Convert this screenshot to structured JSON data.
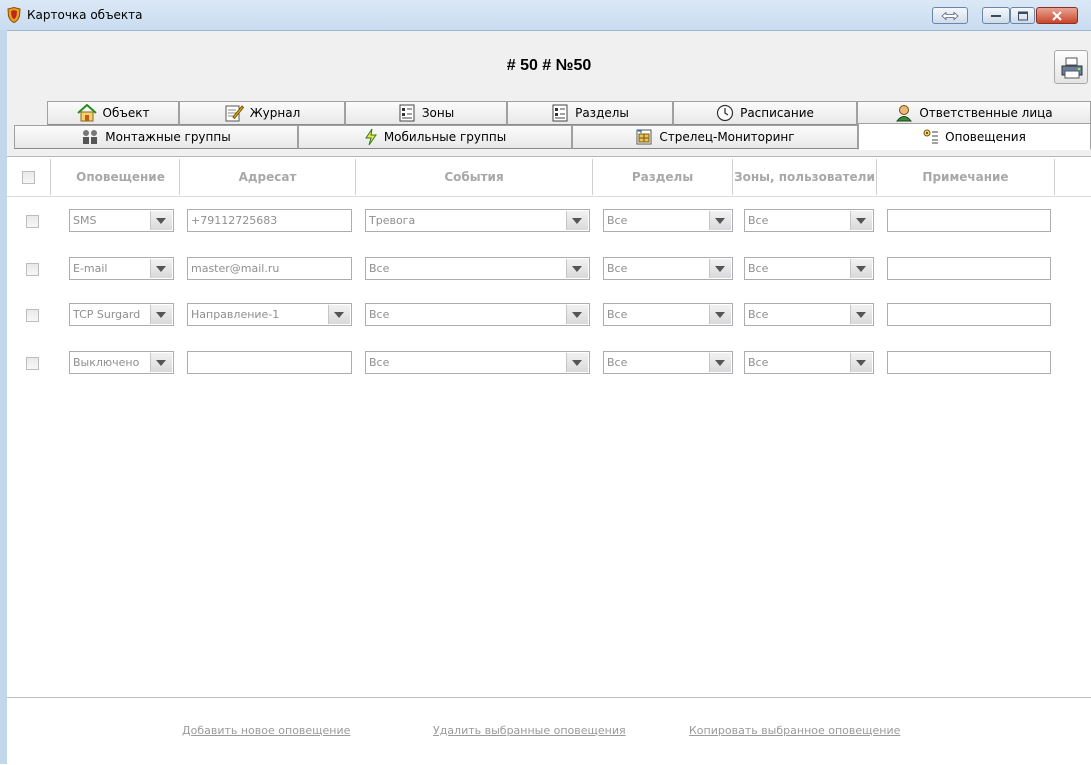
{
  "window": {
    "title": "Карточка объекта",
    "heading": "# 50 # №50"
  },
  "tabs_row1": [
    {
      "label": "Объект",
      "icon": "house-icon"
    },
    {
      "label": "Журнал",
      "icon": "journal-icon"
    },
    {
      "label": "Зоны",
      "icon": "zones-icon"
    },
    {
      "label": "Разделы",
      "icon": "sections-icon"
    },
    {
      "label": "Расписание",
      "icon": "clock-icon"
    },
    {
      "label": "Ответственные лица",
      "icon": "person-icon"
    }
  ],
  "tabs_row2": [
    {
      "label": "Монтажные группы",
      "icon": "installers-icon"
    },
    {
      "label": "Мобильные группы",
      "icon": "lightning-icon"
    },
    {
      "label": "Стрелец-Мониторинг",
      "icon": "monitoring-icon"
    },
    {
      "label": "Оповещения",
      "icon": "notification-icon",
      "active": true
    }
  ],
  "columns": {
    "notification": "Оповещение",
    "recipient": "Адресат",
    "events": "События",
    "sections": "Разделы",
    "zones_users": "Зоны, пользователи",
    "note": "Примечание"
  },
  "rows": [
    {
      "type": "SMS",
      "recipient": "+79112725683",
      "recipient_is_combo": false,
      "events": "Тревога",
      "sections": "Все",
      "zones": "Все",
      "note": ""
    },
    {
      "type": "E-mail",
      "recipient": "master@mail.ru",
      "recipient_is_combo": false,
      "events": "Все",
      "sections": "Все",
      "zones": "Все",
      "note": ""
    },
    {
      "type": "TCP Surgard",
      "recipient": "Направление-1",
      "recipient_is_combo": true,
      "events": "Все",
      "sections": "Все",
      "zones": "Все",
      "note": ""
    },
    {
      "type": "Выключено",
      "recipient": "",
      "recipient_is_combo": false,
      "events": "Все",
      "sections": "Все",
      "zones": "Все",
      "note": ""
    }
  ],
  "actions": {
    "add": "Добавить новое оповещение",
    "delete": "Удалить выбранные оповещения",
    "copy": "Копировать выбранное оповещение"
  },
  "colors": {
    "titlebar": "#c9dcf0",
    "panel": "#f0f0f0",
    "muted_text": "#8f8f8f",
    "close_button": "#c9452b"
  }
}
